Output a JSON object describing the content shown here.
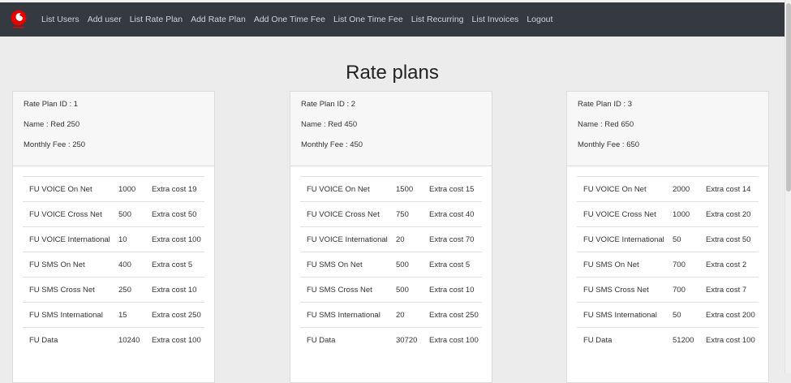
{
  "nav": {
    "items": [
      {
        "label": "List Users"
      },
      {
        "label": "Add user"
      },
      {
        "label": "List Rate Plan"
      },
      {
        "label": "Add Rate Plan"
      },
      {
        "label": "Add One Time Fee"
      },
      {
        "label": "List One Time Fee"
      },
      {
        "label": "List Recurring"
      },
      {
        "label": "List Invoices"
      },
      {
        "label": "Logout"
      }
    ]
  },
  "page": {
    "title": "Rate plans"
  },
  "rate_plans": [
    {
      "id_text": "Rate Plan ID : 1",
      "name_text": "Name : Red 250",
      "fee_text": "Monthly Fee : 250",
      "features": [
        {
          "name": "FU VOICE On Net",
          "amount": "1000",
          "extra": "Extra cost 19"
        },
        {
          "name": "FU VOICE Cross Net",
          "amount": "500",
          "extra": "Extra cost 50"
        },
        {
          "name": "FU VOICE International",
          "amount": "10",
          "extra": "Extra cost 100"
        },
        {
          "name": "FU SMS On Net",
          "amount": "400",
          "extra": "Extra cost 5"
        },
        {
          "name": "FU SMS Cross Net",
          "amount": "250",
          "extra": "Extra cost 10"
        },
        {
          "name": "FU SMS International",
          "amount": "15",
          "extra": "Extra cost 250"
        },
        {
          "name": "FU Data",
          "amount": "10240",
          "extra": "Extra cost 100"
        }
      ]
    },
    {
      "id_text": "Rate Plan ID : 2",
      "name_text": "Name : Red 450",
      "fee_text": "Monthly Fee : 450",
      "features": [
        {
          "name": "FU VOICE On Net",
          "amount": "1500",
          "extra": "Extra cost 15"
        },
        {
          "name": "FU VOICE Cross Net",
          "amount": "750",
          "extra": "Extra cost 40"
        },
        {
          "name": "FU VOICE International",
          "amount": "20",
          "extra": "Extra cost 70"
        },
        {
          "name": "FU SMS On Net",
          "amount": "500",
          "extra": "Extra cost 5"
        },
        {
          "name": "FU SMS Cross Net",
          "amount": "500",
          "extra": "Extra cost 10"
        },
        {
          "name": "FU SMS International",
          "amount": "20",
          "extra": "Extra cost 250"
        },
        {
          "name": "FU Data",
          "amount": "30720",
          "extra": "Extra cost 100"
        }
      ]
    },
    {
      "id_text": "Rate Plan ID : 3",
      "name_text": "Name : Red 650",
      "fee_text": "Monthly Fee : 650",
      "features": [
        {
          "name": "FU VOICE On Net",
          "amount": "2000",
          "extra": "Extra cost 14"
        },
        {
          "name": "FU VOICE Cross Net",
          "amount": "1000",
          "extra": "Extra cost 20"
        },
        {
          "name": "FU VOICE International",
          "amount": "50",
          "extra": "Extra cost 50"
        },
        {
          "name": "FU SMS On Net",
          "amount": "700",
          "extra": "Extra cost 2"
        },
        {
          "name": "FU SMS Cross Net",
          "amount": "700",
          "extra": "Extra cost 7"
        },
        {
          "name": "FU SMS International",
          "amount": "50",
          "extra": "Extra cost 200"
        },
        {
          "name": "FU Data",
          "amount": "51200",
          "extra": "Extra cost 100"
        }
      ]
    }
  ],
  "icons": {
    "brand_logo": "brand-logo-icon"
  },
  "colors": {
    "navbar": "#343a40",
    "brand_red": "#e60000",
    "page_bg": "#ececec"
  }
}
